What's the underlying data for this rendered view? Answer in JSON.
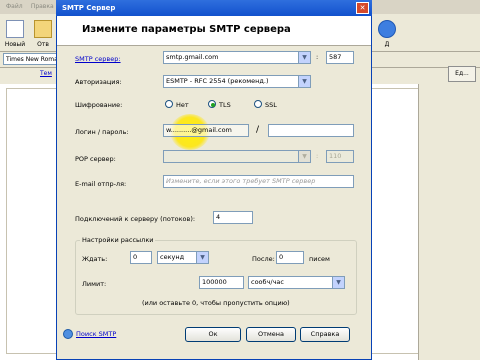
{
  "background": {
    "menu": [
      "Файл",
      "Правка"
    ],
    "toolbar": [
      {
        "label": "Новый"
      },
      {
        "label": "Отв"
      },
      {
        "label": "Д"
      }
    ],
    "font_name": "Times New Roma",
    "link_tab": "Тем",
    "right_button": "Ед..."
  },
  "dialog": {
    "title": "SMTP Сервер",
    "close_glyph": "✕",
    "heading": "Измените параметры SMTP сервера",
    "smtp_server": {
      "label": "SMTP сервер:",
      "value": "smtp.gmail.com",
      "colon": ":",
      "port": "587"
    },
    "auth": {
      "label": "Авторизация:",
      "value": "ESMTP - RFC 2554 (рекоменд.)"
    },
    "encryption": {
      "label": "Шифрование:",
      "options": [
        "Нет",
        "TLS",
        "SSL"
      ],
      "selected": "TLS"
    },
    "login": {
      "label": "Логин / пароль:",
      "value": "w..........@gmail.com",
      "slash": "/",
      "password": ""
    },
    "pop": {
      "label": "POP сервер:",
      "value": "",
      "colon": ":",
      "port": "110"
    },
    "email_return": {
      "label": "E-mail отпр-ля:",
      "placeholder": "Измените, если этого требует SMTP сервер"
    },
    "connections": {
      "label": "Подключений к серверу (потоков):",
      "value": "4"
    },
    "mailing": {
      "title": "Настройки рассылки",
      "wait_label": "Ждать:",
      "wait_value": "0",
      "wait_unit": "секунд",
      "after_label": "После:",
      "after_value": "0",
      "after_unit": "писем",
      "limit_label": "Лимит:",
      "limit_value": "100000",
      "limit_unit": "сообч/час",
      "hint": "(или оставьте 0, чтобы пропустить опцию)"
    },
    "search_smtp": "Поиск SMTP",
    "buttons": {
      "ok": "Ок",
      "cancel": "Отмена",
      "help": "Справка"
    }
  }
}
